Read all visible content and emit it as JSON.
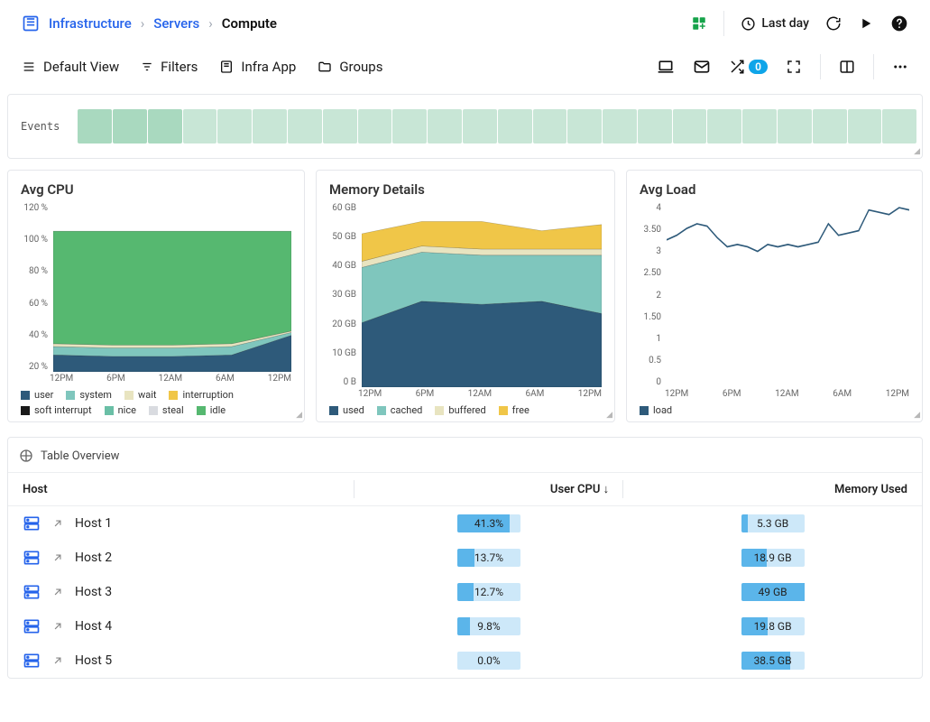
{
  "colors": {
    "green": "#56b870",
    "green2": "#6fc483",
    "teal": "#6abfa6",
    "navy": "#2e5a7a",
    "cyan": "#7fc6bd",
    "cream": "#e8e8c8",
    "yellow": "#f0c648",
    "load": "#2e5a7a",
    "user": "#2e5a7a",
    "system": "#7fc6bd",
    "wait": "#e8e4c0",
    "interruption": "#f0c648",
    "softint": "#1a1a1a",
    "nice": "#6abfa6",
    "steal": "#d9dbe0",
    "idle": "#56b870",
    "used": "#2e5a7a",
    "cached": "#7fc6bd",
    "buffered": "#e8e4c0",
    "free": "#f0c648"
  },
  "breadcrumb": {
    "a": "Infrastructure",
    "b": "Servers",
    "c": "Compute"
  },
  "header": {
    "timerange": "Last day"
  },
  "toolbar": {
    "view": "Default View",
    "filters": "Filters",
    "infra": "Infra App",
    "groups": "Groups",
    "badge": "0"
  },
  "events": {
    "label": "Events",
    "blocks": 24
  },
  "cards": {
    "cpu": "Avg CPU",
    "mem": "Memory Details",
    "load": "Avg Load"
  },
  "legend_cpu": [
    "user",
    "system",
    "wait",
    "interruption",
    "soft interrupt",
    "nice",
    "steal",
    "idle"
  ],
  "legend_mem": [
    "used",
    "cached",
    "buffered",
    "free"
  ],
  "legend_load": [
    "load"
  ],
  "xticks": [
    "12PM",
    "6PM",
    "12AM",
    "6AM",
    "12PM"
  ],
  "chart_data": [
    {
      "type": "area",
      "title": "Avg CPU",
      "ylabel": "%",
      "ylim": [
        0,
        120
      ],
      "categories": [
        "12PM",
        "6PM",
        "12AM",
        "6AM",
        "12PM"
      ],
      "yticks": [
        "120 %",
        "100 %",
        "80 %",
        "60 %",
        "40 %",
        "20 %"
      ],
      "series": [
        {
          "name": "user",
          "color": "user",
          "values": [
            12,
            11,
            11,
            12,
            26
          ]
        },
        {
          "name": "system",
          "color": "system",
          "values": [
            6,
            6,
            6,
            6,
            2
          ]
        },
        {
          "name": "wait",
          "color": "wait",
          "values": [
            2,
            2,
            2,
            2,
            1
          ]
        },
        {
          "name": "idle",
          "color": "idle",
          "values": [
            80,
            81,
            81,
            80,
            71
          ]
        }
      ]
    },
    {
      "type": "area",
      "title": "Memory Details",
      "ylabel": "GB",
      "ylim": [
        0,
        60
      ],
      "categories": [
        "12PM",
        "6PM",
        "12AM",
        "6AM",
        "12PM"
      ],
      "yticks": [
        "60 GB",
        "50 GB",
        "40 GB",
        "30 GB",
        "20 GB",
        "10 GB",
        "0 B"
      ],
      "series": [
        {
          "name": "used",
          "color": "used",
          "values": [
            21,
            28,
            27,
            28,
            24
          ]
        },
        {
          "name": "cached",
          "color": "cached",
          "values": [
            18,
            16,
            16,
            15,
            19
          ]
        },
        {
          "name": "buffered",
          "color": "buffered",
          "values": [
            2,
            2,
            2,
            2,
            2
          ]
        },
        {
          "name": "free",
          "color": "free",
          "values": [
            9,
            8,
            9,
            6,
            8
          ]
        }
      ]
    },
    {
      "type": "line",
      "title": "Avg Load",
      "ylabel": "",
      "ylim": [
        0,
        4
      ],
      "categories": [
        "12PM",
        "6PM",
        "12AM",
        "6AM",
        "12PM"
      ],
      "yticks": [
        "4",
        "3.50",
        "3",
        "2.50",
        "2",
        "1.50",
        "1",
        "0.5",
        "0"
      ],
      "series": [
        {
          "name": "load",
          "color": "load",
          "values": [
            3.2,
            3.3,
            3.45,
            3.55,
            3.5,
            3.25,
            3.05,
            3.1,
            3.05,
            2.95,
            3.1,
            3.05,
            3.1,
            3.05,
            3.1,
            3.15,
            3.55,
            3.3,
            3.35,
            3.4,
            3.85,
            3.8,
            3.75,
            3.9,
            3.85
          ]
        }
      ]
    }
  ],
  "table": {
    "title": "Table Overview",
    "columns": [
      "Host",
      "User CPU ↓",
      "Memory Used"
    ],
    "rows": [
      {
        "host": "Host 1",
        "cpu": "41.3%",
        "cpu_pct": 41.3,
        "mem": "5.3 GB",
        "mem_pct": 11
      },
      {
        "host": "Host 2",
        "cpu": "13.7%",
        "cpu_pct": 13.7,
        "mem": "18.9 GB",
        "mem_pct": 40
      },
      {
        "host": "Host 3",
        "cpu": "12.7%",
        "cpu_pct": 12.7,
        "mem": "49 GB",
        "mem_pct": 100
      },
      {
        "host": "Host 4",
        "cpu": "9.8%",
        "cpu_pct": 9.8,
        "mem": "19.8 GB",
        "mem_pct": 42
      },
      {
        "host": "Host 5",
        "cpu": "0.0%",
        "cpu_pct": 0,
        "mem": "38.5 GB",
        "mem_pct": 78
      }
    ]
  }
}
